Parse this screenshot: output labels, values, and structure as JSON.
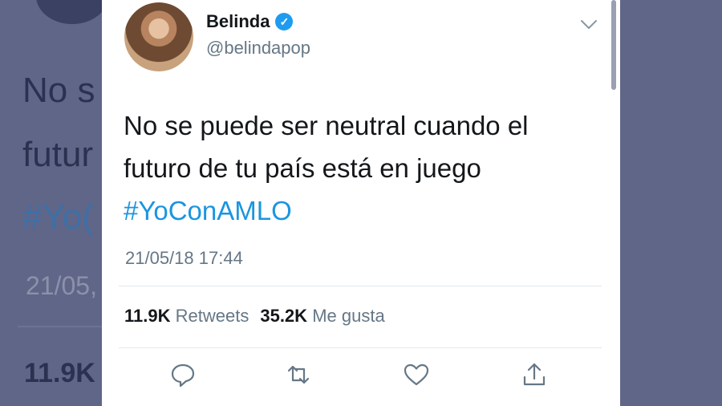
{
  "background": {
    "line1": "No s",
    "line2": "futur",
    "hashtag": "#Yo(",
    "time": "21/05,",
    "count": "11.9K"
  },
  "tweet": {
    "author_name": "Belinda",
    "handle": "@belindapop",
    "text_line1": "No se puede ser neutral cuando el",
    "text_line2": "futuro de tu país está en juego",
    "hashtag": "#YoConAMLO",
    "timestamp": "21/05/18 17:44"
  },
  "stats": {
    "retweets_count": "11.9K",
    "retweets_label": "Retweets",
    "likes_count": "35.2K",
    "likes_label": "Me gusta"
  },
  "icons": {
    "verified": "verified-badge-icon",
    "menu": "chevron-down-icon",
    "reply": "reply-icon",
    "retweet": "retweet-icon",
    "like": "heart-icon",
    "share": "share-icon"
  },
  "colors": {
    "accent": "#1b95e0",
    "verified": "#1d9bf0",
    "text": "#14171a",
    "muted": "#657786",
    "backdrop": "#5f6688"
  }
}
